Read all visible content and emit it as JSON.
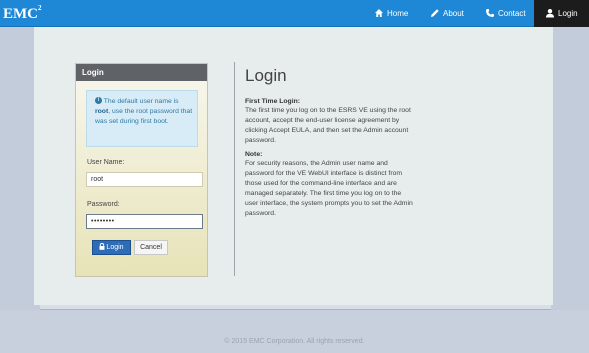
{
  "brand": {
    "name": "EMC",
    "superscript": "2"
  },
  "nav": {
    "home": "Home",
    "about": "About",
    "contact": "Contact",
    "login": "Login"
  },
  "login_panel": {
    "title": "Login",
    "info_parts": [
      "The default user name is ",
      "root",
      ", use the root password that was set during first boot."
    ],
    "username_label": "User Name:",
    "username_value": "root",
    "password_label": "Password:",
    "password_value": "••••••••",
    "login_button": "Login",
    "cancel_button": "Cancel"
  },
  "content": {
    "title": "Login",
    "first_time_heading": "First Time Login:",
    "first_time_text": "The first time you log on to the ESRS VE using the root account, accept the end-user license agreement by clicking Accept EULA, and then set the Admin account password.",
    "note_heading": "Note:",
    "note_text": "For security reasons, the Admin user name and password for the VE WebUI interface is distinct from those used for the command-line interface and are managed separately. The first time you log on to the user interface, the system prompts you to set the Admin password."
  },
  "footer": "© 2015 EMC Corporation. All rights reserved.",
  "colors": {
    "navbar": "#1e88d6",
    "active_nav": "#1c1c1c",
    "login_button": "#2d6cb8",
    "info_text": "#2f78a8"
  }
}
